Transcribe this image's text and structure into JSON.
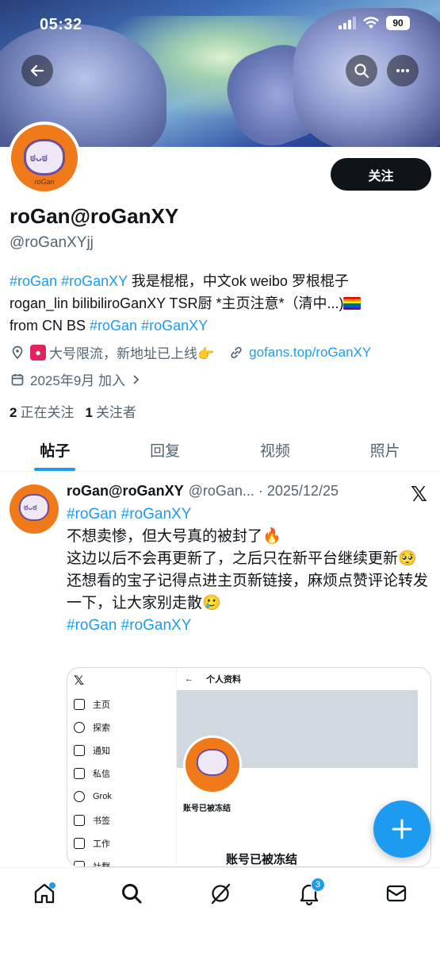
{
  "status_bar": {
    "time": "05:32",
    "battery": "90"
  },
  "banner": {
    "back_icon": "arrow-left-icon",
    "search_icon": "search-icon",
    "more_icon": "more-horizontal-icon"
  },
  "profile": {
    "display_name": "roGan@roGanXY",
    "handle": "@roGanXYjj",
    "follow_button": "关注",
    "avatar_text": "roGan",
    "bio": {
      "hashtag1": "#roGan",
      "hashtag2": "#roGanXY",
      "text1": " 我是棍棍，中文ok weibo 罗根棍子",
      "text2": "rogan_lin bilibiliroGanXY TSR厨 *主页注意*（清中...)",
      "text3": "from CN BS ",
      "hashtag3": "#roGan",
      "hashtag4": "#roGanXY"
    },
    "location": "大号限流，新地址已上线👉",
    "website": "gofans.top/roGanXY",
    "joined": "2025年9月 加入",
    "following_count": "2",
    "following_label": "正在关注",
    "followers_count": "1",
    "followers_label": "关注者"
  },
  "tabs": [
    {
      "label": "帖子",
      "active": true
    },
    {
      "label": "回复",
      "active": false
    },
    {
      "label": "视频",
      "active": false
    },
    {
      "label": "照片",
      "active": false
    }
  ],
  "post": {
    "author_name": "roGan@roGanXY",
    "author_handle": "@roGan... · 2025/12/25",
    "hashtags_top": "#roGan #roGanXY",
    "line1": "不想卖惨，但大号真的被封了🔥",
    "line2": "这边以后不会再更新了，之后只在新平台继续更新🥺",
    "line3": "还想看的宝子记得点进主页新链接，麻烦点赞评论转发一下，让大家别走散🥲",
    "hashtags_bottom": "#roGan #roGanXY",
    "embed": {
      "nav_items": [
        "主页",
        "探索",
        "通知",
        "私信",
        "Grok",
        "书签",
        "工作",
        "社群"
      ],
      "header_title": "个人资料",
      "frozen_small": "账号已被冻结",
      "frozen_large": "账号已被冻结"
    }
  },
  "fab": {
    "icon": "plus-icon"
  },
  "bottom_nav": {
    "items": [
      "home-icon",
      "search-icon",
      "grok-icon",
      "notifications-icon",
      "messages-icon"
    ],
    "notification_badge": "3"
  },
  "colors": {
    "accent": "#1d9bf0",
    "text": "#0f1419",
    "secondary": "#536471",
    "avatar_bg": "#f07a1a"
  }
}
